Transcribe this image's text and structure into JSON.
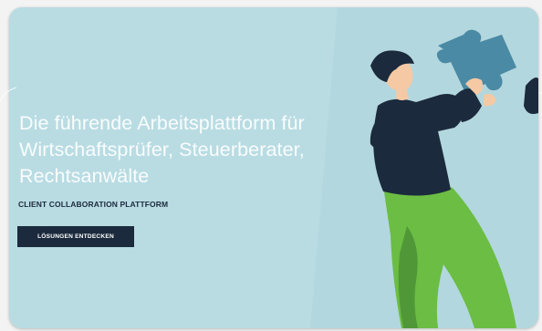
{
  "hero": {
    "headline_lines": [
      "Die führende Arbeitsplattform für",
      "Wirtschaftsprüfer, Steuerberater,",
      "Rechtsanwälte"
    ],
    "subtitle": "CLIENT COLLABORATION PLATTFORM",
    "cta_label": "LÖSUNGEN ENTDECKEN"
  },
  "illustration": {
    "figure": "person-holding-puzzle-piece",
    "puzzle_piece_color": "#4a8aa4",
    "shirt_color": "#1b2a3c",
    "pants_color": "#6bbd44",
    "skin_color": "#f4c9a4"
  },
  "colors": {
    "card_background": "#b9dce3",
    "text_dark": "#1b2a3c",
    "button_background": "#1b2a3c"
  }
}
